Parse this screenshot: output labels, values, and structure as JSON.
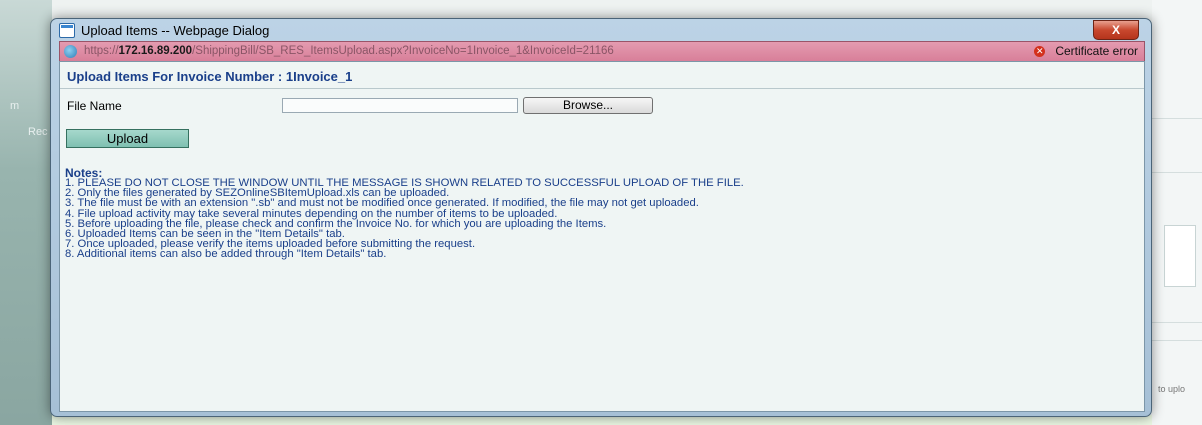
{
  "background": {
    "left_labels": [
      "m",
      "Rec"
    ],
    "right_partial_text": "to uplo"
  },
  "dialog": {
    "title": "Upload Items -- Webpage Dialog",
    "close_label": "X",
    "url_scheme": "https://",
    "url_host": "172.16.89.200",
    "url_path": "/ShippingBill/SB_RES_ItemsUpload.aspx?InvoiceNo=1Invoice_1&InvoiceId=21166",
    "certificate_label": "Certificate error"
  },
  "form": {
    "heading": "Upload Items For Invoice Number : 1Invoice_1",
    "file_label": "File Name",
    "file_value": "",
    "browse_label": "Browse...",
    "upload_label": "Upload"
  },
  "notes": {
    "title": "Notes:",
    "items": [
      "1. PLEASE DO NOT CLOSE THE WINDOW UNTIL THE MESSAGE IS SHOWN RELATED TO SUCCESSFUL UPLOAD OF THE FILE.",
      "2. Only the files generated by SEZOnlineSBItemUpload.xls can be uploaded.",
      "3. The file must be with an extension \".sb\" and must not be modified once generated. If modified, the file may not get uploaded.",
      "4. File upload activity may take several minutes depending on the number of items to be uploaded.",
      "5. Before uploading the file, please check and confirm the Invoice No. for which you are uploading the Items.",
      "6. Uploaded Items can be seen in the \"Item Details\" tab.",
      "7. Once uploaded, please verify the items uploaded before submitting the request.",
      "8. Additional items can also be added through \"Item Details\" tab."
    ]
  },
  "colors": {
    "heading": "#1a3f8a",
    "upload_button": "#8cc9bb",
    "address_bar_error": "#d87f99"
  }
}
